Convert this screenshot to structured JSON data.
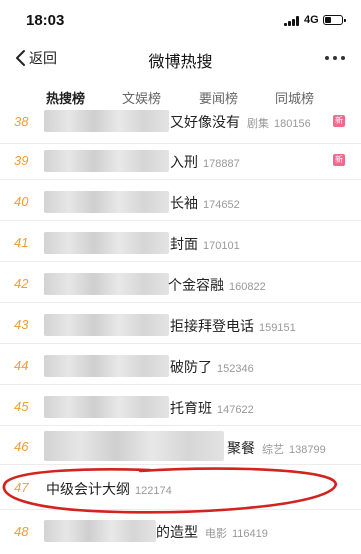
{
  "status_bar": {
    "time": "18:03",
    "network": "4G"
  },
  "nav": {
    "back_label": "返回",
    "title": "微博热搜"
  },
  "tabs": [
    {
      "label": "热搜榜",
      "active": true
    },
    {
      "label": "文娱榜",
      "active": false
    },
    {
      "label": "要闻榜",
      "active": false
    },
    {
      "label": "同城榜",
      "active": false
    }
  ],
  "list": [
    {
      "rank": "38",
      "title": "又好像没有",
      "category": "剧集",
      "heat": "180156",
      "badge": "新"
    },
    {
      "rank": "39",
      "title": "入刑",
      "category": "",
      "heat": "178887",
      "badge": "新"
    },
    {
      "rank": "40",
      "title": "长袖",
      "category": "",
      "heat": "174652",
      "badge": ""
    },
    {
      "rank": "41",
      "title": "封面",
      "category": "",
      "heat": "170101",
      "badge": ""
    },
    {
      "rank": "42",
      "title": "个金容融",
      "category": "",
      "heat": "160822",
      "badge": ""
    },
    {
      "rank": "43",
      "title": "拒接拜登电话",
      "category": "",
      "heat": "159151",
      "badge": ""
    },
    {
      "rank": "44",
      "title": "破防了",
      "category": "",
      "heat": "152346",
      "badge": ""
    },
    {
      "rank": "45",
      "title": "托育班",
      "category": "",
      "heat": "147622",
      "badge": ""
    },
    {
      "rank": "46",
      "title": "聚餐",
      "category": "综艺",
      "heat": "138799",
      "badge": ""
    },
    {
      "rank": "47",
      "title": "中级会计大纲",
      "category": "",
      "heat": "122174",
      "badge": ""
    },
    {
      "rank": "48",
      "title": "的造型",
      "category": "电影",
      "heat": "116419",
      "badge": ""
    }
  ],
  "colors": {
    "rank": "#f29c38",
    "badge": "#f06a8c",
    "annotation": "#d2231f"
  }
}
